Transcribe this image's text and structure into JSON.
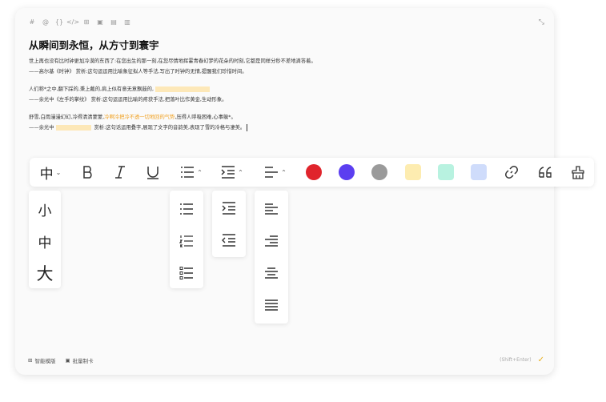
{
  "editor": {
    "toolbar_icons": [
      "hash-icon",
      "at-icon",
      "braces-icon",
      "code-icon",
      "table-icon",
      "image-icon",
      "document-icon",
      "file-icon"
    ],
    "title": "从瞬间到永恒，从方寸到寰宇",
    "paragraphs": [
      {
        "lines": [
          {
            "text": "世上再也没有比时钟更加冷漠的东西了:在您出生的那一刻,在您尽情地挥霍青春幻梦的花朵的时刻,它都是同样分秒不差地滴答着。"
          },
          {
            "text": "——高尔基《时钟》 赏析:这句运运用比喻象征拟人等手法,写出了时钟的无情,提醒我们珍惜时间。"
          }
        ]
      },
      {
        "lines": [
          {
            "text": "人们称*之中,翻下踩的,秉上戴的,肩上似有意无意飘鼓的,",
            "highlight": "after"
          },
          {
            "text": "——余光中《左手的掌纹》 赏析:这句运运用比喻的疼获手法,把落叶比作黄金,生动形象。"
          }
        ]
      },
      {
        "lines": [
          {
            "text": "舒雪,白雨漫漫幻幻,冷得清清蒙蒙,",
            "orange": "冷啊冷把冷不透一切地回的气势",
            "text_after": ",压得人呼吸困难,心事躲*。"
          },
          {
            "text_before": "——余光中",
            "text": "赏析:这句话运用叠字,展现了文字的音韵美,表现了雪的冷格与凄美。",
            "highlight": "middle",
            "caret": true
          }
        ]
      }
    ],
    "collapse_icon": "collapse-icon"
  },
  "format_toolbar": {
    "font_size_label": "中",
    "tools": [
      "font-size",
      "bold-icon",
      "italic-icon",
      "underline-icon",
      "list-icon",
      "indent-icon",
      "align-icon",
      "link-icon",
      "quote-icon",
      "clear-format-icon"
    ],
    "colors": [
      {
        "name": "red",
        "hex": "#e0242c",
        "shape": "circle"
      },
      {
        "name": "purple",
        "hex": "#5b3ef0",
        "shape": "circle"
      },
      {
        "name": "gray",
        "hex": "#9a9a9a",
        "shape": "circle"
      },
      {
        "name": "yellow",
        "hex": "#fdecb0",
        "shape": "rounded"
      },
      {
        "name": "mint",
        "hex": "#b8f2e0",
        "shape": "rounded"
      },
      {
        "name": "blue",
        "hex": "#cfdcfb",
        "shape": "rounded"
      }
    ]
  },
  "font_size_menu": {
    "options": [
      "小",
      "中",
      "大"
    ]
  },
  "list_menu": {
    "options": [
      "bullet-list-icon",
      "ordered-list-icon",
      "checklist-icon"
    ]
  },
  "indent_menu": {
    "options": [
      "indent-icon",
      "outdent-icon"
    ]
  },
  "align_menu": {
    "options": [
      "align-left-icon",
      "align-right-icon",
      "align-center-icon",
      "align-justify-icon"
    ]
  },
  "footer": {
    "smart_template": "智能模版",
    "batch_card": "批量制卡",
    "shortcut": "(Shift+Enter)",
    "submit_icon": "check-icon"
  }
}
